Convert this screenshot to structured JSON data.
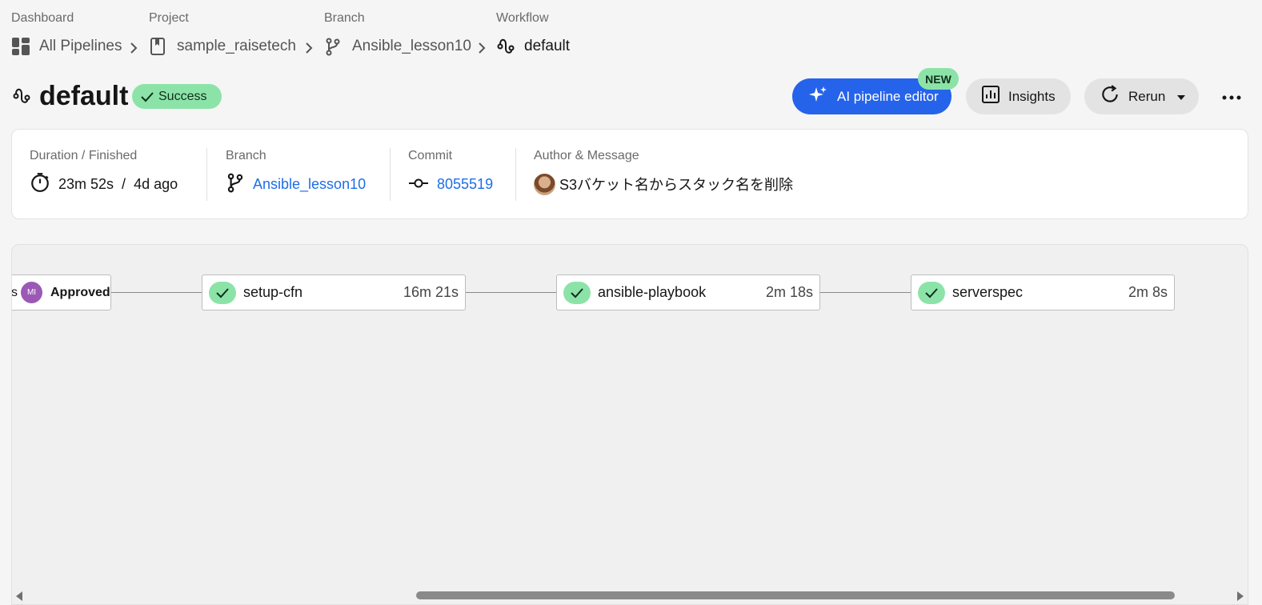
{
  "breadcrumb": {
    "items": [
      {
        "category": "Dashboard",
        "label": "All Pipelines",
        "icon": "dashboard-icon"
      },
      {
        "category": "Project",
        "label": "sample_raisetech",
        "icon": "project-bookmark-icon"
      },
      {
        "category": "Branch",
        "label": "Ansible_lesson10",
        "icon": "branch-icon"
      },
      {
        "category": "Workflow",
        "label": "default",
        "icon": "workflow-icon"
      }
    ]
  },
  "header": {
    "title": "default",
    "status": "Success",
    "ai_editor_label": "AI pipeline editor",
    "new_badge": "NEW",
    "insights_label": "Insights",
    "rerun_label": "Rerun",
    "more_icon": "more-horizontal-icon"
  },
  "info": {
    "duration_label": "Duration / Finished",
    "duration": "23m 52s",
    "separator": "/",
    "finished": "4d ago",
    "branch_label": "Branch",
    "branch": "Ansible_lesson10",
    "commit_label": "Commit",
    "commit": "8055519",
    "author_label": "Author & Message",
    "message": "S3バケット名からスタック名を削除"
  },
  "pipeline": {
    "approval": {
      "prefix": "s",
      "avatar_initials": "MI",
      "label": "Approved"
    },
    "jobs": [
      {
        "name": "setup-cfn",
        "duration": "16m 21s"
      },
      {
        "name": "ansible-playbook",
        "duration": "2m 18s"
      },
      {
        "name": "serverspec",
        "duration": "2m 8s"
      }
    ]
  },
  "colors": {
    "accent": "#2563eb",
    "success": "#8ce3a8",
    "link": "#1d6ee8"
  }
}
